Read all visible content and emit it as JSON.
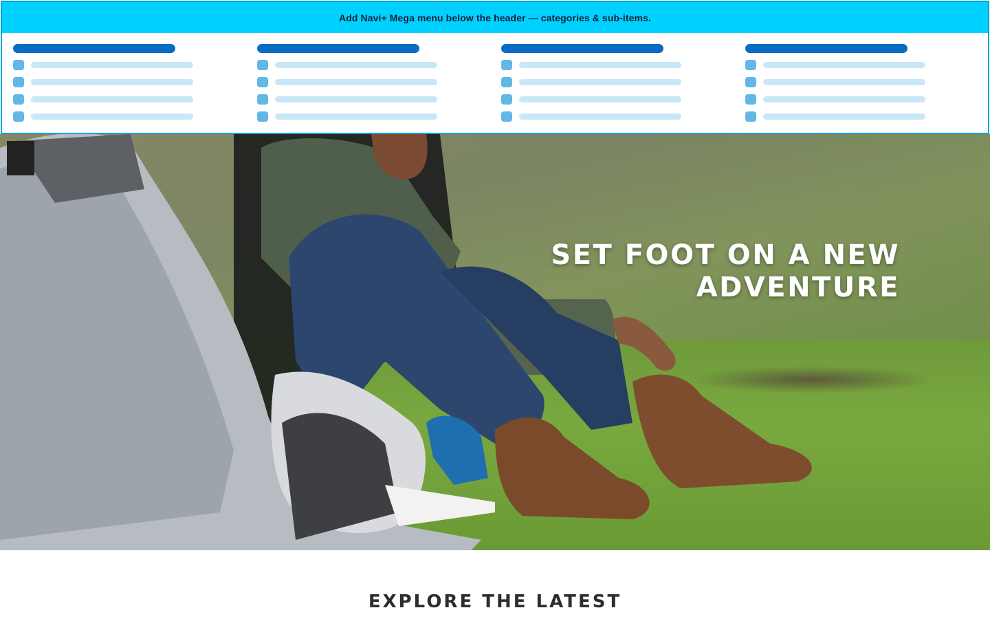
{
  "mega_menu": {
    "banner_text": "Add Navi+ Mega menu below the header — categories & sub-items.",
    "colors": {
      "banner": "#00d1ff",
      "border": "#0aa3d8",
      "category_bar": "#0a6cc4",
      "sub_item_icon": "#63b7e6",
      "sub_item_line": "#c8e8f7"
    },
    "columns": [
      {
        "sub_item_count": 4
      },
      {
        "sub_item_count": 4
      },
      {
        "sub_item_count": 4
      },
      {
        "sub_item_count": 4
      }
    ]
  },
  "hero": {
    "title_line1": "SET FOOT ON A NEW",
    "title_line2": "ADVENTURE",
    "image": "woman-lacing-boots-beside-tent-on-grass"
  },
  "explore": {
    "title": "EXPLORE THE LATEST"
  }
}
